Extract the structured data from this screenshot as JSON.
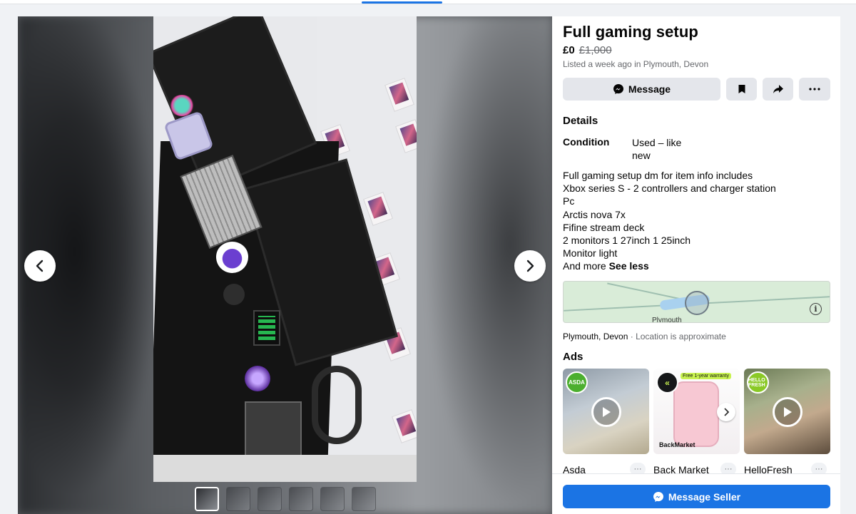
{
  "listing": {
    "title": "Full gaming setup",
    "price": "£0",
    "original_price": "£1,000",
    "meta": "Listed a week ago in Plymouth, Devon"
  },
  "actions": {
    "message_label": "Message",
    "save_icon": "bookmark-icon",
    "share_icon": "share-icon",
    "more_icon": "ellipsis-icon"
  },
  "details": {
    "heading": "Details",
    "condition_label": "Condition",
    "condition_value": "Used – like new",
    "description_lines": [
      "Full gaming setup dm for item info includes",
      "Xbox series S - 2 controllers and charger station",
      "Pc",
      "Arctis nova 7x",
      "Fifine stream deck",
      "2 monitors 1 27inch 1 25inch",
      "Monitor light",
      "And more"
    ],
    "see_less": "See less"
  },
  "location": {
    "map_label": "Plymouth",
    "place": "Plymouth, Devon",
    "note": "· Location is approximate"
  },
  "ads": {
    "heading": "Ads",
    "items": [
      {
        "name": "Asda",
        "logo_text": "ASDA"
      },
      {
        "name": "Back Market",
        "logo_text": "«",
        "badge": "Free 1-year warranty",
        "brand": "BackMarket"
      },
      {
        "name": "HelloFresh",
        "logo_text": "HELLO FRESH"
      }
    ],
    "more_label": "···"
  },
  "footer": {
    "message_seller_label": "Message Seller"
  },
  "colors": {
    "accent": "#1b74e4",
    "page_bg": "#f0f2f5",
    "button_bg": "#e4e6eb"
  }
}
